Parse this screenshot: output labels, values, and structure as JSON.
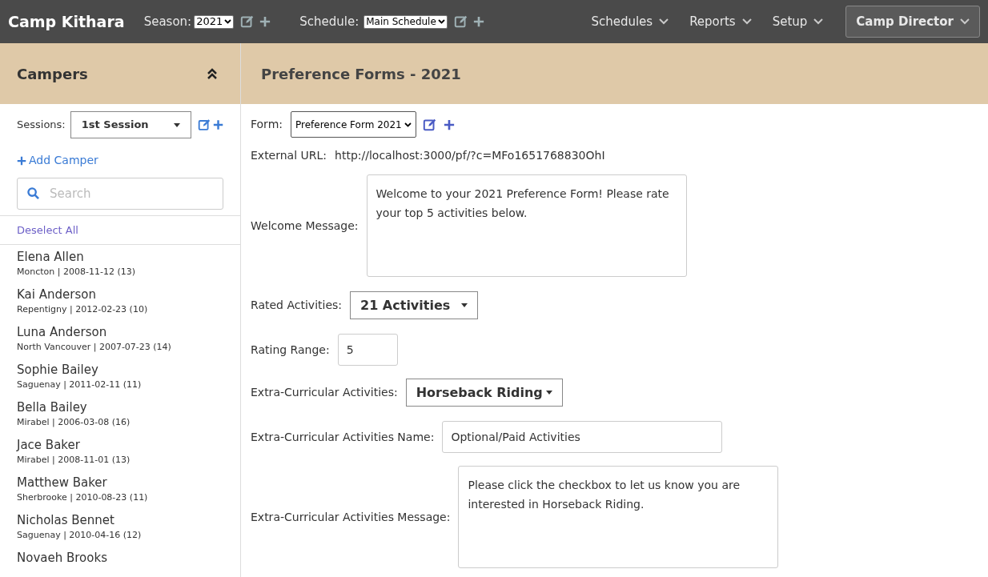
{
  "navbar": {
    "brand": "Camp Kithara",
    "season": {
      "label": "Season:",
      "value": "2021"
    },
    "schedule": {
      "label": "Schedule:",
      "value": "Main Schedule"
    },
    "menus": [
      {
        "label": "Schedules"
      },
      {
        "label": "Reports"
      },
      {
        "label": "Setup"
      }
    ],
    "user_menu": "Camp Director"
  },
  "sidebar": {
    "title": "Campers",
    "sessions": {
      "label": "Sessions:",
      "value": "1st Session"
    },
    "add_link": "Add Camper",
    "search": {
      "placeholder": "Search"
    },
    "deselect": "Deselect All",
    "campers": [
      {
        "name": "Elena Allen",
        "details": "Moncton | 2008-11-12 (13)"
      },
      {
        "name": "Kai Anderson",
        "details": "Repentigny | 2012-02-23 (10)"
      },
      {
        "name": "Luna Anderson",
        "details": "North Vancouver | 2007-07-23 (14)"
      },
      {
        "name": "Sophie Bailey",
        "details": "Saguenay | 2011-02-11 (11)"
      },
      {
        "name": "Bella Bailey",
        "details": "Mirabel | 2006-03-08 (16)"
      },
      {
        "name": "Jace Baker",
        "details": "Mirabel | 2008-11-01 (13)"
      },
      {
        "name": "Matthew Baker",
        "details": "Sherbrooke | 2010-08-23 (11)"
      },
      {
        "name": "Nicholas Bennet",
        "details": "Saguenay | 2010-04-16 (12)"
      },
      {
        "name": "Novaeh Brooks"
      }
    ]
  },
  "main": {
    "title": "Preference Forms - 2021",
    "fields": [
      {
        "kind": "select",
        "label": "Form:",
        "value": "Preference Form 2021"
      },
      {
        "kind": "text",
        "label": "External URL:",
        "value": "http://localhost:3000/pf/?c=MFo1651768830OhI"
      },
      {
        "kind": "textarea",
        "label": "Welcome Message:",
        "value": "Welcome to your 2021 Preference Form! Please rate your top 5 activities below."
      },
      {
        "kind": "dropdown",
        "label": "Rated Activities:",
        "value": "21 Activities"
      },
      {
        "kind": "input",
        "label": "Rating Range:",
        "value": "5"
      },
      {
        "kind": "dropdown",
        "label": "Extra-Curricular Activities:",
        "value": "Horseback Riding"
      },
      {
        "kind": "input",
        "label": "Extra-Curricular Activities Name:",
        "value": "Optional/Paid Activities"
      },
      {
        "kind": "textarea",
        "label": "Extra-Curricular Activities Message:",
        "value": "Please click the checkbox to let us know you are interested in Horseback Riding."
      }
    ]
  }
}
